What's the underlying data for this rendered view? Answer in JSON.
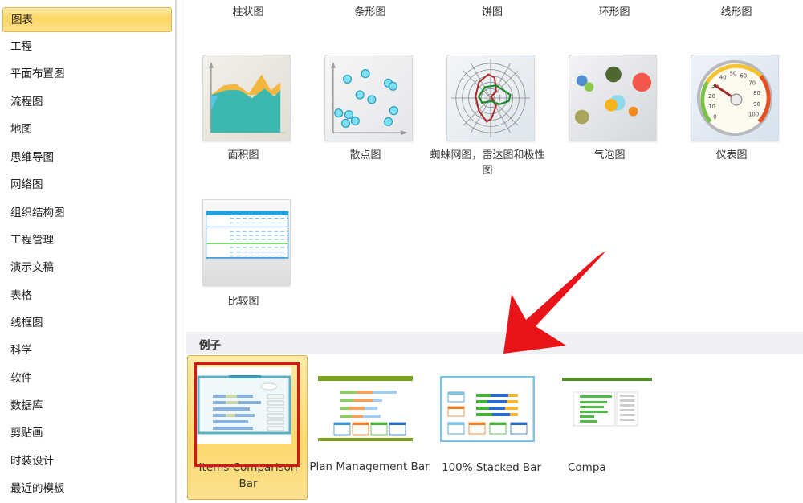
{
  "sidebar": {
    "items": [
      {
        "label": "图表",
        "active": true
      },
      {
        "label": "工程"
      },
      {
        "label": "平面布置图"
      },
      {
        "label": "流程图"
      },
      {
        "label": "地图"
      },
      {
        "label": "思维导图"
      },
      {
        "label": "网络图"
      },
      {
        "label": "组织结构图"
      },
      {
        "label": "工程管理"
      },
      {
        "label": "演示文稿"
      },
      {
        "label": "表格"
      },
      {
        "label": "线框图"
      },
      {
        "label": "科学"
      },
      {
        "label": "软件"
      },
      {
        "label": "数据库"
      },
      {
        "label": "剪贴画"
      },
      {
        "label": "时装设计"
      },
      {
        "label": "最近的模板"
      }
    ]
  },
  "categories": {
    "top_row": [
      "柱状图",
      "条形图",
      "饼图",
      "环形图",
      "线形图"
    ],
    "tiles": [
      {
        "label": "面积图",
        "icon": "area-chart-icon"
      },
      {
        "label": "散点图",
        "icon": "scatter-chart-icon"
      },
      {
        "label": "蜘蛛网图，雷达图和极性图",
        "icon": "radar-chart-icon"
      },
      {
        "label": "气泡图",
        "icon": "bubble-chart-icon"
      },
      {
        "label": "仪表图",
        "icon": "gauge-chart-icon"
      },
      {
        "label": "比较图",
        "icon": "comparison-chart-icon"
      }
    ],
    "gauge_ticks": [
      "0",
      "10",
      "20",
      "30",
      "40",
      "50",
      "60",
      "70",
      "80",
      "90",
      "100"
    ]
  },
  "examples": {
    "section_title": "例子",
    "items": [
      {
        "label": "Items Comparison Bar",
        "selected": true
      },
      {
        "label": "Plan Management Bar"
      },
      {
        "label": "100% Stacked Bar"
      },
      {
        "label": "Compa"
      }
    ]
  },
  "annotation": {
    "arrow_color": "#e8141a",
    "highlight_color": "#d8161a"
  }
}
